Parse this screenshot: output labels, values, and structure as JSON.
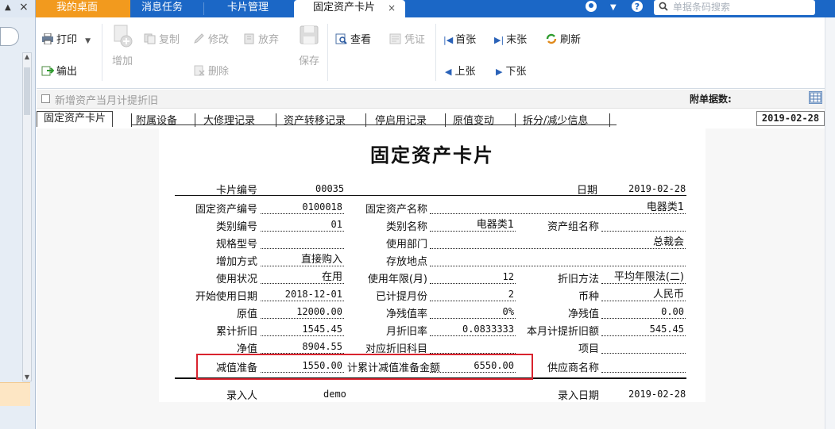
{
  "top_tabs": {
    "home": "我的桌面",
    "messages": "消息任务",
    "card_mgmt": "卡片管理",
    "active": "固定资产卡片",
    "close_glyph": "×"
  },
  "left_ctrl": {
    "collapse": "▲",
    "close": "×"
  },
  "search": {
    "placeholder": "单据条码搜索"
  },
  "toolbar": {
    "print": "打印",
    "export": "输出",
    "add": "增加",
    "copy": "复制",
    "modify": "修改",
    "abandon": "放弃",
    "delete": "删除",
    "save": "保存",
    "view": "查看",
    "voucher": "凭证",
    "first": "首张",
    "last": "末张",
    "prev": "上张",
    "next": "下张",
    "refresh": "刷新"
  },
  "options": {
    "new_asset_checkbox": "新增资产当月计提折旧",
    "attachment_count": "附单据数:"
  },
  "subtabs": [
    "固定资产卡片",
    "附属设备",
    "大修理记录",
    "资产转移记录",
    "停启用记录",
    "原值变动",
    "拆分/减少信息"
  ],
  "record_date": "2019-02-28",
  "card": {
    "title": "固定资产卡片",
    "card_no_label": "卡片编号",
    "card_no": "00035",
    "date_label": "日期",
    "date": "2019-02-28",
    "asset_code_label": "固定资产编号",
    "asset_code": "0100018",
    "asset_name_label": "固定资产名称",
    "asset_name": "电器类1",
    "category_code_label": "类别编号",
    "category_code": "01",
    "category_name_label": "类别名称",
    "category_name": "电器类1",
    "asset_group_label": "资产组名称",
    "asset_group": "",
    "spec_label": "规格型号",
    "spec": "",
    "department_label": "使用部门",
    "department": "总裁会",
    "add_method_label": "增加方式",
    "add_method": "直接购入",
    "location_label": "存放地点",
    "location": "",
    "status_label": "使用状况",
    "status": "在用",
    "life_label": "使用年限(月)",
    "life": "12",
    "dep_method_label": "折旧方法",
    "dep_method": "平均年限法(二)",
    "start_date_label": "开始使用日期",
    "start_date": "2018-12-01",
    "months_label": "已计提月份",
    "months": "2",
    "currency_label": "币种",
    "currency": "人民币",
    "original_label": "原值",
    "original": "12000.00",
    "salvage_rate_label": "净残值率",
    "salvage_rate": "0%",
    "salvage_label": "净残值",
    "salvage": "0.00",
    "accum_dep_label": "累计折旧",
    "accum_dep": "1545.45",
    "monthly_rate_label": "月折旧率",
    "monthly_rate": "0.0833333",
    "monthly_dep_label": "本月计提折旧额",
    "monthly_dep": "545.45",
    "net_label": "净值",
    "net": "8904.55",
    "dep_account_label": "对应折旧科目",
    "dep_account": "",
    "project_label": "项目",
    "project": "",
    "impairment_label": "减值准备",
    "impairment": "1550.00",
    "accum_impairment_label": "累计减值准备金额",
    "accum_impairment_prefix": "计",
    "accum_impairment": "6550.00",
    "supplier_label": "供应商名称",
    "supplier": "",
    "entered_by_label": "录入人",
    "entered_by": "demo",
    "entry_date_label": "录入日期",
    "entry_date": "2019-02-28"
  },
  "colors": {
    "tab_blue": "#1b67c6",
    "home_orange": "#f29a1e",
    "highlight_red": "#d9232e"
  }
}
